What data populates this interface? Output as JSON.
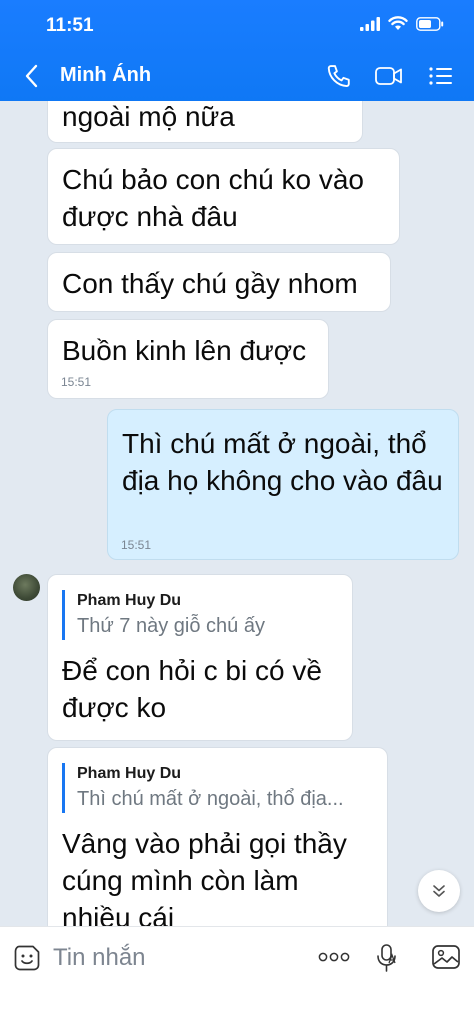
{
  "status_bar": {
    "time": "11:51"
  },
  "header": {
    "contact_name": "Minh Ánh"
  },
  "messages": [
    {
      "text": "ngoài mộ nữa"
    },
    {
      "text": "Chú bảo con chú ko vào được nhà đâu"
    },
    {
      "text": "Con thấy chú gầy nhom"
    },
    {
      "text": "Buồn kinh lên được",
      "time": "15:51"
    },
    {
      "text": "Thì chú mất ở ngoài, thổ địa họ không cho vào đâu",
      "time": "15:51"
    },
    {
      "quote_name": "Pham Huy Du",
      "quote_text": "Thứ 7 này giỗ chú ấy",
      "text": "Để con hỏi c bi có về được ko"
    },
    {
      "quote_name": "Pham Huy Du",
      "quote_text": "Thì chú mất ở ngoài, thổ địa...",
      "text": "Vâng vào phải gọi thầy cúng mình còn làm nhiều cái"
    }
  ],
  "composer": {
    "placeholder": "Tin nhắn"
  },
  "icons": {
    "back": "chevron-left-icon",
    "call": "phone-icon",
    "video": "video-camera-icon",
    "menu": "list-menu-icon",
    "emoji": "sticker-smile-icon",
    "more": "more-dots-icon",
    "voice": "microphone-icon",
    "image": "image-icon",
    "scroll": "double-chevron-down-icon"
  },
  "colors": {
    "header": "#1a7dff",
    "chat_background": "#e2e9f1",
    "own_bubble": "#d6efff",
    "bubble": "#ffffff",
    "quote_bar": "#1877f2"
  }
}
